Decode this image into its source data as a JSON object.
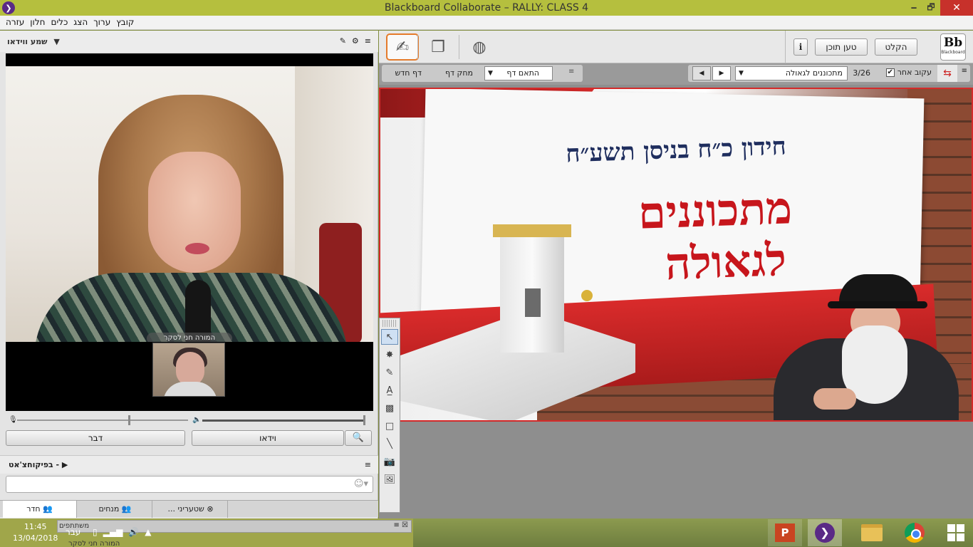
{
  "window": {
    "title": "Blackboard Collaborate – RALLY: CLASS 4",
    "min": "🗕",
    "max": "🗗",
    "close": "✕"
  },
  "menu": [
    "קובץ",
    "ערוך",
    "הצג",
    "כלים",
    "חלון",
    "עזרה"
  ],
  "video_panel": {
    "title": "שמע ווידאו",
    "speaker_label": "המורה חני לסקר",
    "talk_label": "דבר",
    "video_label": "וידאו"
  },
  "chat": {
    "title": "- בפיקוחצ'אט"
  },
  "tabs": [
    "חדר",
    "מנחים",
    "שטעריני ..."
  ],
  "toolbar": {
    "record_label": "הקלט",
    "load_label": "טען תוכן",
    "info_label": "i",
    "logo_label": "Bb",
    "logo_text": "Blackboard"
  },
  "page_controls": {
    "new_page": "דף חדש",
    "clear_page": "מחק דף",
    "fit_select": "התאם דף",
    "follow_label": "עקוב אחר",
    "page_count": "3/26",
    "page_select": "מתכוננים לגאולה"
  },
  "slide": {
    "subtitle": "חידון כ״ח בניסן תשע״ח",
    "title_line1": "מתכוננים",
    "title_line2": "לגאולה"
  },
  "participants": {
    "title": "משתתפים",
    "first_name": "המורה חני לסקר"
  },
  "taskbar": {
    "time": "11:45",
    "date": "13/04/2018",
    "language": "עבר"
  },
  "colors": {
    "title_bar": "#b5bf3e",
    "accent_red": "#c7161c",
    "navy": "#1f2e5e"
  }
}
